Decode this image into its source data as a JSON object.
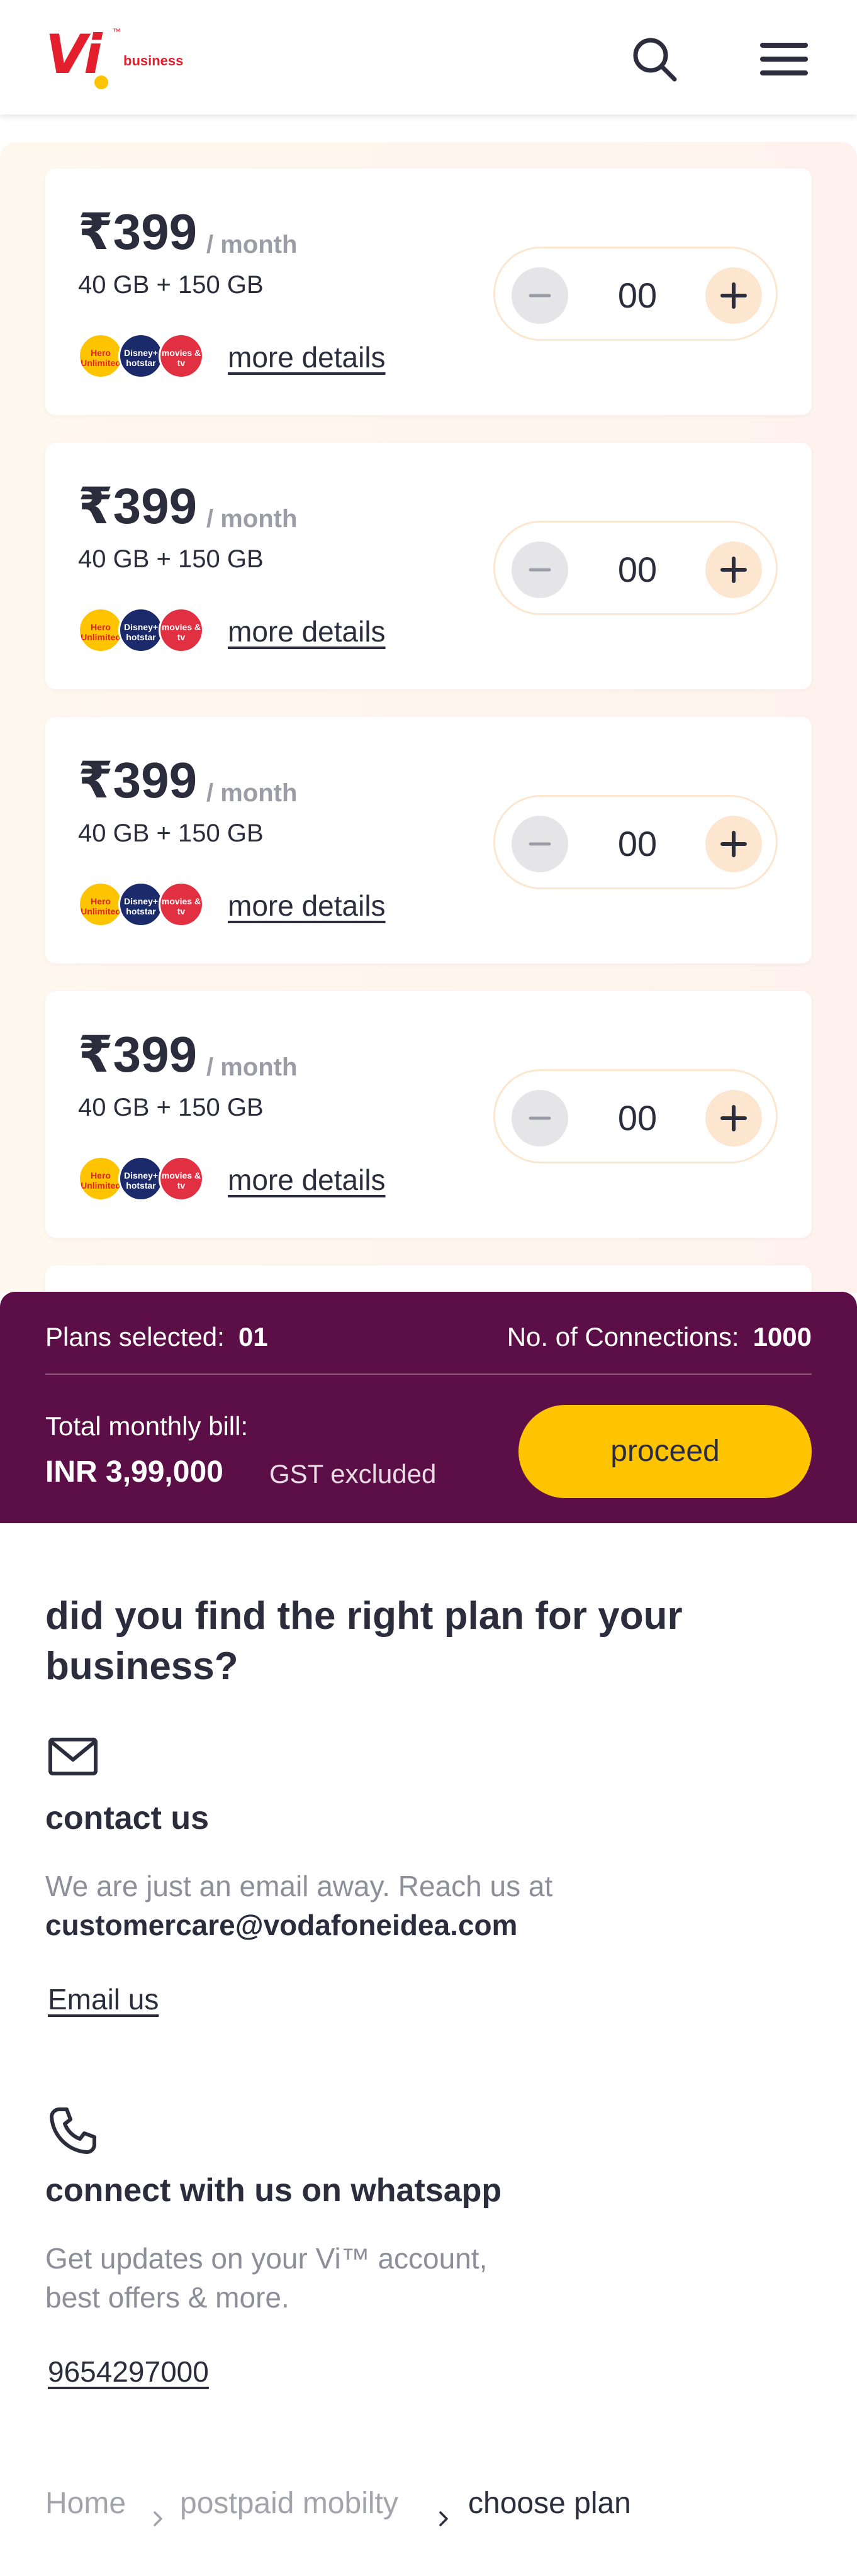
{
  "header": {
    "logo_text": "Vi",
    "logo_tm": "™",
    "logo_sub": "business",
    "search_icon": "search-icon",
    "menu_icon": "hamburger-menu-icon"
  },
  "plans": [
    {
      "price": "₹399",
      "period": "/ month",
      "data": "40 GB + 150 GB",
      "ott": [
        "Hero Unlimited",
        "Disney+ hotstar",
        "movies & tv"
      ],
      "more_details": "more details",
      "quantity": "00"
    },
    {
      "price": "₹399",
      "period": "/ month",
      "data": "40 GB + 150 GB",
      "ott": [
        "Hero Unlimited",
        "Disney+ hotstar",
        "movies & tv"
      ],
      "more_details": "more details",
      "quantity": "00"
    },
    {
      "price": "₹399",
      "period": "/ month",
      "data": "40 GB + 150 GB",
      "ott": [
        "Hero Unlimited",
        "Disney+ hotstar",
        "movies & tv"
      ],
      "more_details": "more details",
      "quantity": "00"
    },
    {
      "price": "₹399",
      "period": "/ month",
      "data": "40 GB + 150 GB",
      "ott": [
        "Hero Unlimited",
        "Disney+ hotstar",
        "movies & tv"
      ],
      "more_details": "more details",
      "quantity": "00"
    }
  ],
  "summary": {
    "plans_label": "Plans selected:",
    "plans_value": "01",
    "connections_label": "No. of Connections:",
    "connections_value": "1000",
    "total_label": "Total monthly bill:",
    "total_value": "INR 3,99,000",
    "gst_note": "GST excluded",
    "proceed_label": "proceed"
  },
  "help": {
    "title": "did you find the right plan for your business?",
    "contact": {
      "title": "contact us",
      "text": "We are just an email away. Reach us at",
      "email": "customercare@vodafoneidea.com",
      "link": "Email us"
    },
    "whatsapp": {
      "title": "connect with us on whatsapp",
      "text_line1": "Get updates on your Vi™ account,",
      "text_line2": "best offers & more.",
      "phone": "9654297000"
    }
  },
  "breadcrumb": {
    "items": [
      "Home",
      "postpaid mobilty",
      "choose plan"
    ]
  },
  "colors": {
    "brand_red": "#e41f2d",
    "brand_yellow": "#ffc400",
    "summary_bg": "#5c0e46",
    "text_dark": "#2b2d3d"
  }
}
